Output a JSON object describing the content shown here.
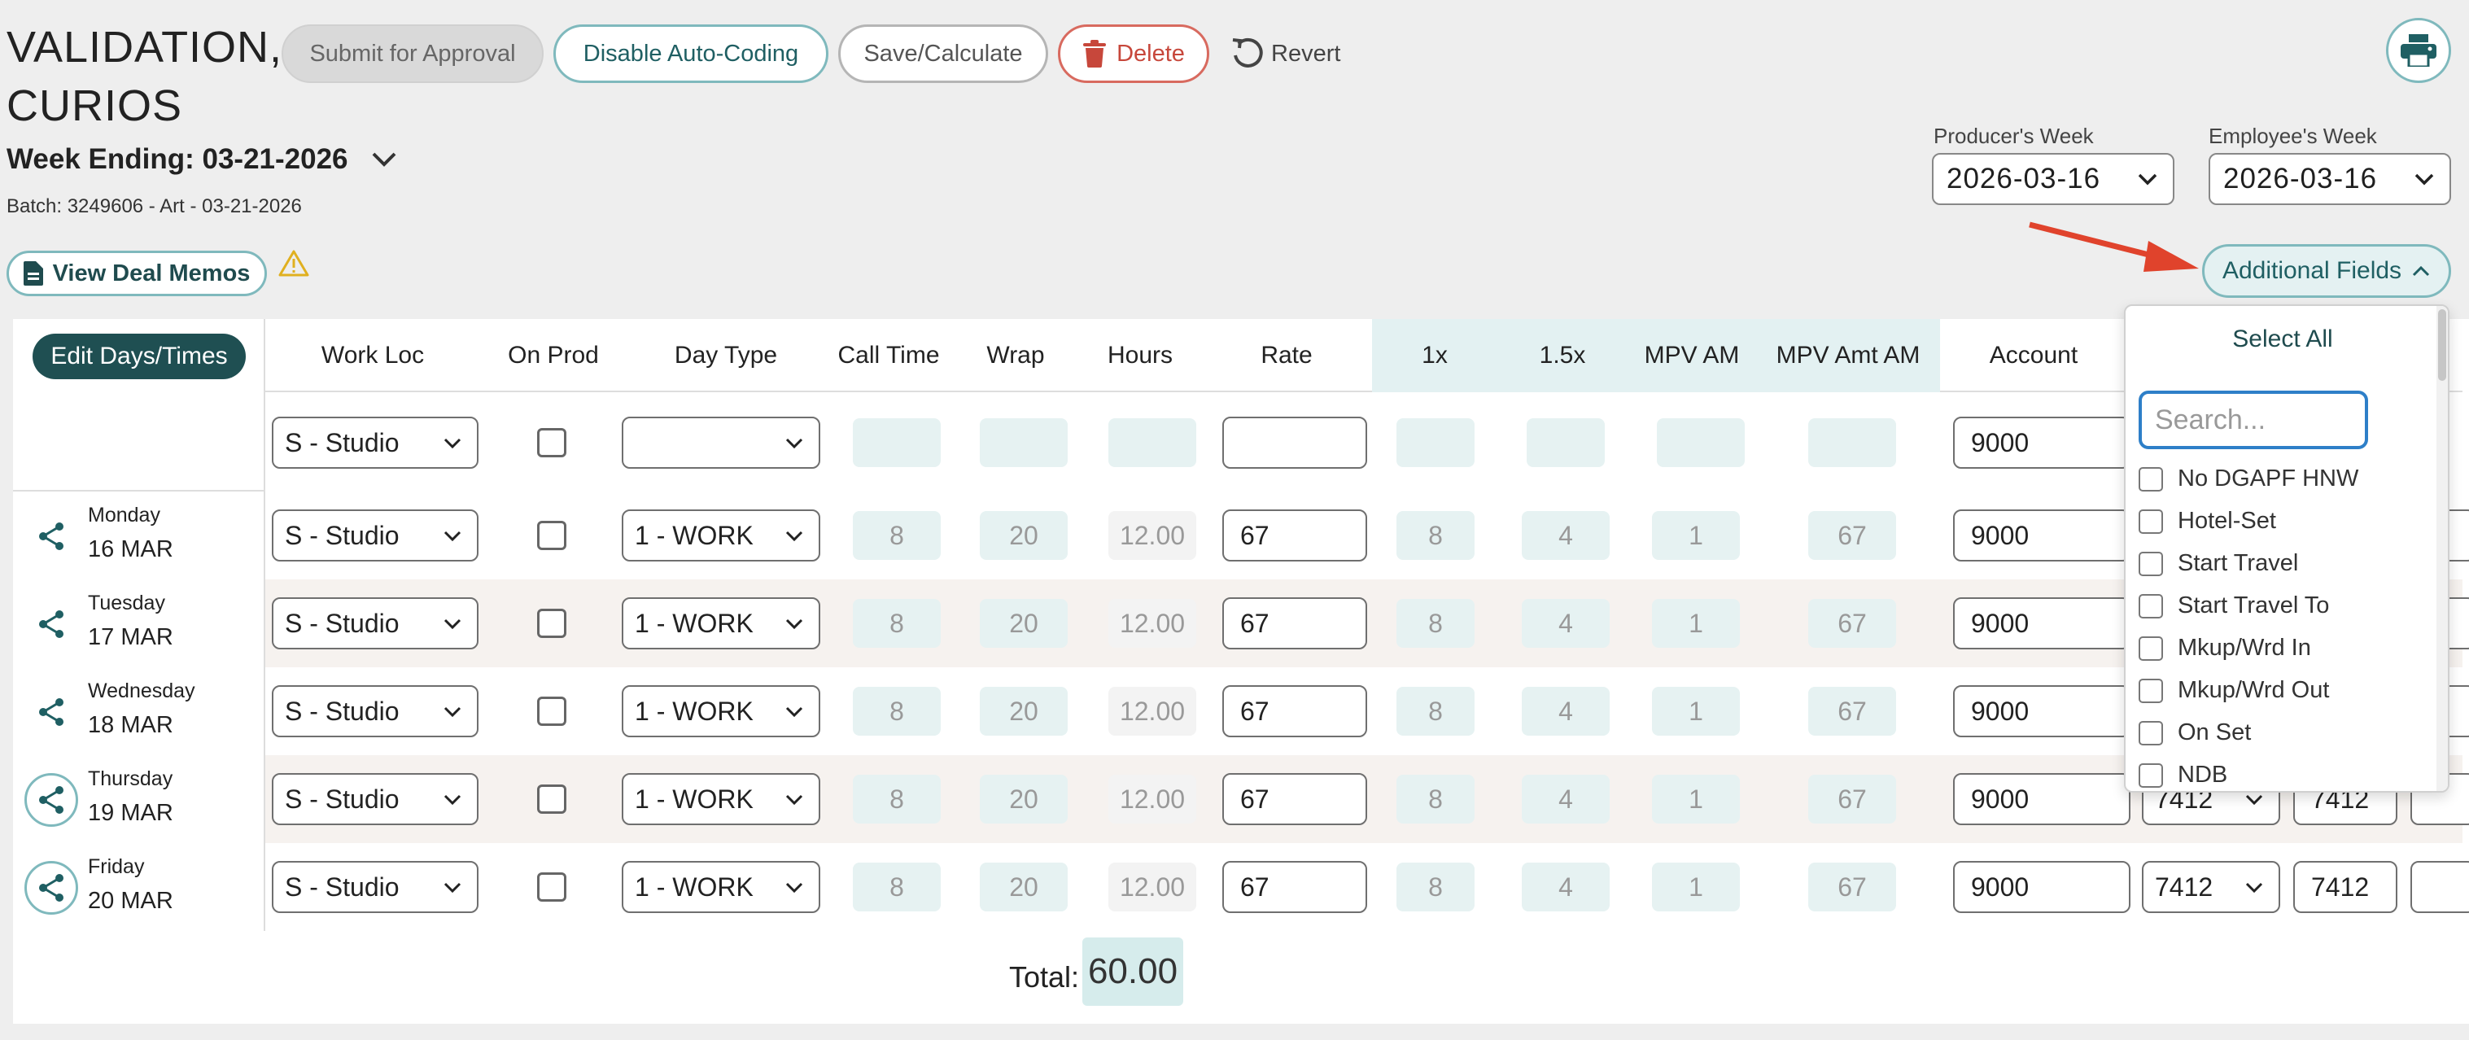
{
  "header": {
    "title_line1": "VALIDATION,",
    "title_line2": "CURIOS",
    "submit_label": "Submit for Approval",
    "disable_label": "Disable Auto-Coding",
    "save_label": "Save/Calculate",
    "delete_label": "Delete",
    "revert_label": "Revert"
  },
  "week": {
    "ending_label": "Week Ending: 03-21-2026",
    "batch": "Batch: 3249606 - Art - 03-21-2026",
    "producers_week_label": "Producer's Week",
    "producers_week_value": "2026-03-16",
    "employees_week_label": "Employee's Week",
    "employees_week_value": "2026-03-16"
  },
  "actions": {
    "view_deal_memos": "View Deal Memos",
    "additional_fields": "Additional Fields",
    "edit_days_times": "Edit Days/Times"
  },
  "columns": [
    "Work Loc",
    "On Prod",
    "Day Type",
    "Call Time",
    "Wrap",
    "Hours",
    "Rate",
    "1x",
    "1.5x",
    "MPV AM",
    "MPV Amt AM",
    "Account"
  ],
  "default_row": {
    "work_loc": "S - Studio",
    "day_type": "",
    "rate": "",
    "account": "9000"
  },
  "days": [
    {
      "weekday": "Monday",
      "date": "16 MAR",
      "work_loc": "S - Studio",
      "day_type": "1 - WORK",
      "call": "8",
      "wrap": "20",
      "hours": "12.00",
      "rate": "67",
      "x1": "8",
      "x15": "4",
      "mpv": "1",
      "mpv_amt": "67",
      "account": "9000",
      "col2": "",
      "col3": ""
    },
    {
      "weekday": "Tuesday",
      "date": "17 MAR",
      "work_loc": "S - Studio",
      "day_type": "1 - WORK",
      "call": "8",
      "wrap": "20",
      "hours": "12.00",
      "rate": "67",
      "x1": "8",
      "x15": "4",
      "mpv": "1",
      "mpv_amt": "67",
      "account": "9000",
      "col2": "",
      "col3": ""
    },
    {
      "weekday": "Wednesday",
      "date": "18 MAR",
      "work_loc": "S - Studio",
      "day_type": "1 - WORK",
      "call": "8",
      "wrap": "20",
      "hours": "12.00",
      "rate": "67",
      "x1": "8",
      "x15": "4",
      "mpv": "1",
      "mpv_amt": "67",
      "account": "9000",
      "col2": "",
      "col3": ""
    },
    {
      "weekday": "Thursday",
      "date": "19 MAR",
      "work_loc": "S - Studio",
      "day_type": "1 - WORK",
      "call": "8",
      "wrap": "20",
      "hours": "12.00",
      "rate": "67",
      "x1": "8",
      "x15": "4",
      "mpv": "1",
      "mpv_amt": "67",
      "account": "9000",
      "col2": "7412",
      "col3": "7412"
    },
    {
      "weekday": "Friday",
      "date": "20 MAR",
      "work_loc": "S - Studio",
      "day_type": "1 - WORK",
      "call": "8",
      "wrap": "20",
      "hours": "12.00",
      "rate": "67",
      "x1": "8",
      "x15": "4",
      "mpv": "1",
      "mpv_amt": "67",
      "account": "9000",
      "col2": "7412",
      "col3": "7412"
    }
  ],
  "total": {
    "label": "Total:",
    "value": "60.00"
  },
  "additional_fields_menu": {
    "select_all": "Select All",
    "search_placeholder": "Search...",
    "items": [
      "No DGAPF HNW",
      "Hotel-Set",
      "Start Travel",
      "Start Travel To",
      "Mkup/Wrd In",
      "Mkup/Wrd Out",
      "On Set",
      "NDB"
    ]
  },
  "colors": {
    "teal_dark": "#1f4f52",
    "teal_border": "#7fb9bd",
    "teal_light": "#e3f1f2",
    "delete_red": "#c7473b",
    "arrow_red": "#e0432c"
  },
  "icons": [
    "trash-icon",
    "revert-icon",
    "print-icon",
    "chevron-down-icon",
    "document-icon",
    "warning-icon",
    "chevron-up-icon",
    "share-icon"
  ]
}
